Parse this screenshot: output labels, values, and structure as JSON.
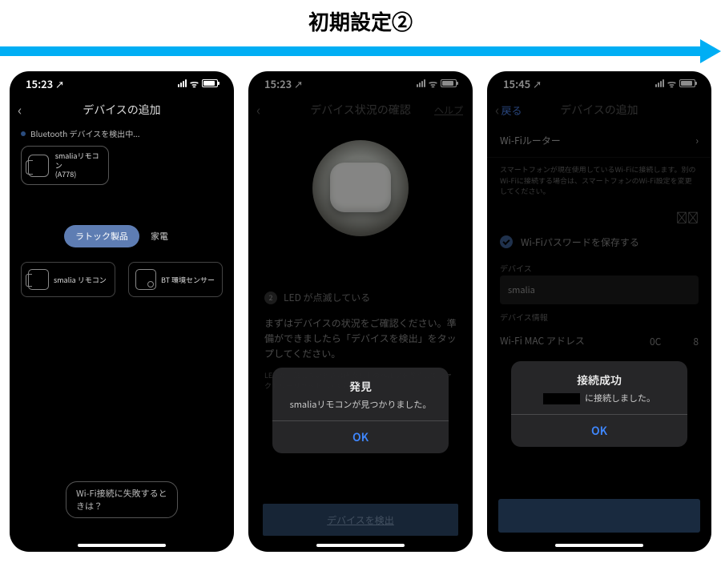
{
  "header": {
    "title": "初期設定②"
  },
  "status": {
    "time_a": "15:23",
    "time_b": "15:23",
    "time_c": "15:45",
    "loc_icon": "↗",
    "wifi_icon": "ᯤ"
  },
  "screen1": {
    "title": "デバイスの追加",
    "scanning": "Bluetooth デバイスを検出中...",
    "found_name": "smaliaリモコン",
    "found_id": "(A778)",
    "tabs": {
      "active": "ラトック製品",
      "other": "家電"
    },
    "cat_remote": "smalia リモコン",
    "cat_sensor": "BT 環境センサー",
    "help_chip": "Wi-Fi接続に失敗するときは？"
  },
  "screen2": {
    "title": "デバイス状況の確認",
    "help": "ヘルプ",
    "step2_label": "LED が点滅している",
    "step2_num": "2",
    "instruction": "まずはデバイスの状況をご確認ください。準備ができましたら「デバイスを検出」をタップしてください。",
    "sub": "LED が点滅しないときは画面右上のヘルプを参照してファクトリーリセットしてください。",
    "button": "デバイスを検出",
    "modal": {
      "title": "発見",
      "msg": "smaliaリモコンが見つかりました。",
      "ok": "OK"
    }
  },
  "screen3": {
    "title": "デバイスの追加",
    "back": "戻る",
    "router_label": "Wi-Fiルーター",
    "router_chev": "›",
    "note": "スマートフォンが現在使用しているWi-Fiに接続します。別のWi-Fiに接続する場合は、スマートフォンのWi-Fi設定を変更してください。",
    "eye": "👁",
    "save_pw": "Wi-Fiパスワードを保存する",
    "device_section": "デバイス",
    "device_value": "smalia",
    "info_section": "デバイス情報",
    "mac_label": "Wi-Fi MAC アドレス",
    "mac_prefix": "0C",
    "mac_suffix": "8",
    "modal": {
      "title": "接続成功",
      "msg_prefix": "",
      "msg_suffix": "に接続しました。",
      "ok": "OK"
    }
  }
}
